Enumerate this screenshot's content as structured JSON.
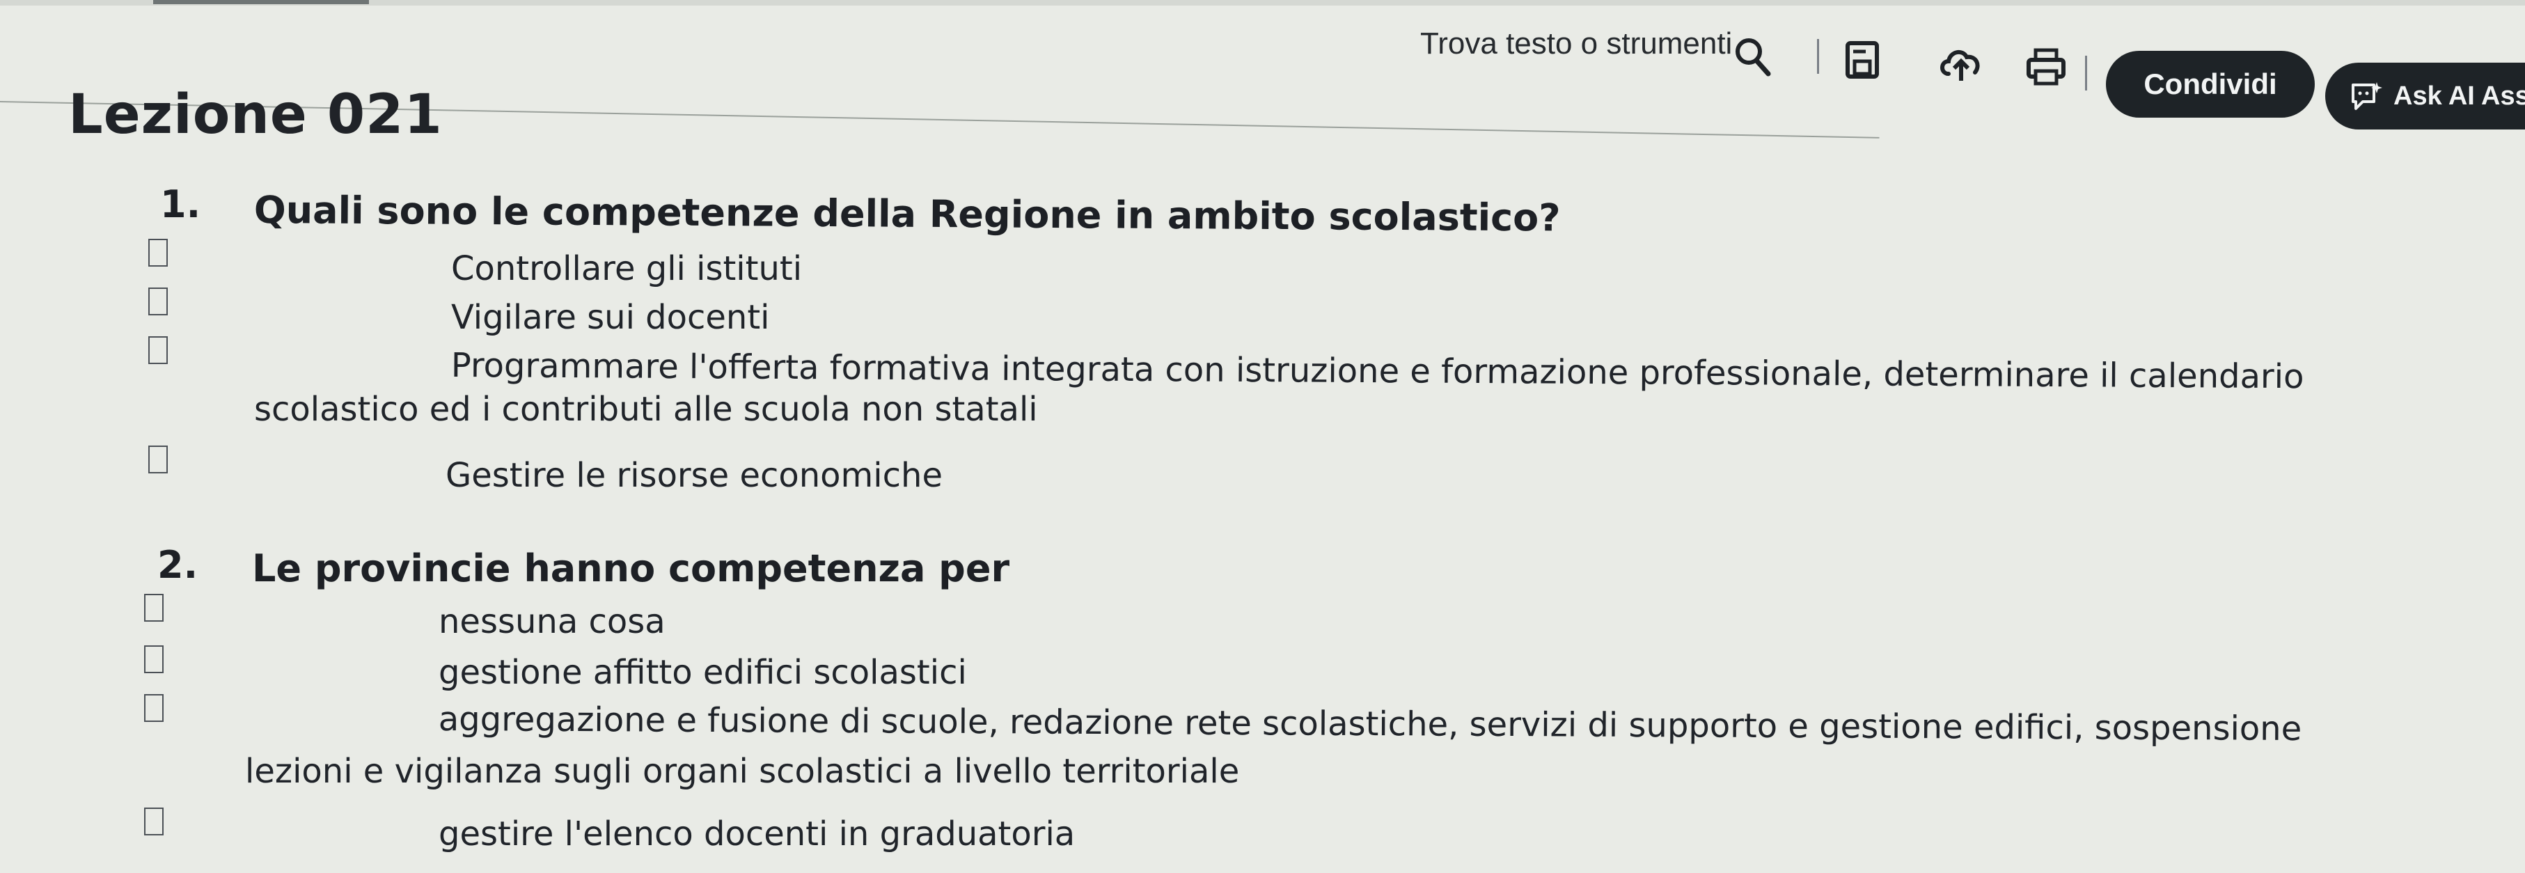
{
  "toolbar": {
    "search_label": "Trova testo o strumenti",
    "share_label": "Condividi",
    "ai_label": "Ask AI Assi",
    "icons": [
      "search-icon",
      "save-icon",
      "upload-cloud-icon",
      "print-icon",
      "ai-assistant-icon"
    ]
  },
  "lesson": {
    "title": "Lezione 021"
  },
  "questions": [
    {
      "number": "1.",
      "text": "Quali sono le competenze della Regione in ambito scolastico?",
      "options": [
        "Controllare gli istituti",
        "Vigilare sui docenti",
        "Programmare l'offerta formativa integrata con istruzione e formazione professionale, determinare il calendario",
        "scolastico ed i contributi alle scuola non statali",
        "Gestire le risorse economiche"
      ]
    },
    {
      "number": "2.",
      "text": "Le provincie hanno competenza per",
      "options": [
        "nessuna cosa",
        "gestione affitto edifici scolastici",
        "aggregazione e fusione di scuole, redazione rete scolastiche, servizi di supporto e gestione edifici, sospensione",
        "lezioni e vigilanza sugli organi scolastici a livello territoriale",
        "gestire l'elenco docenti in graduatoria"
      ]
    }
  ]
}
